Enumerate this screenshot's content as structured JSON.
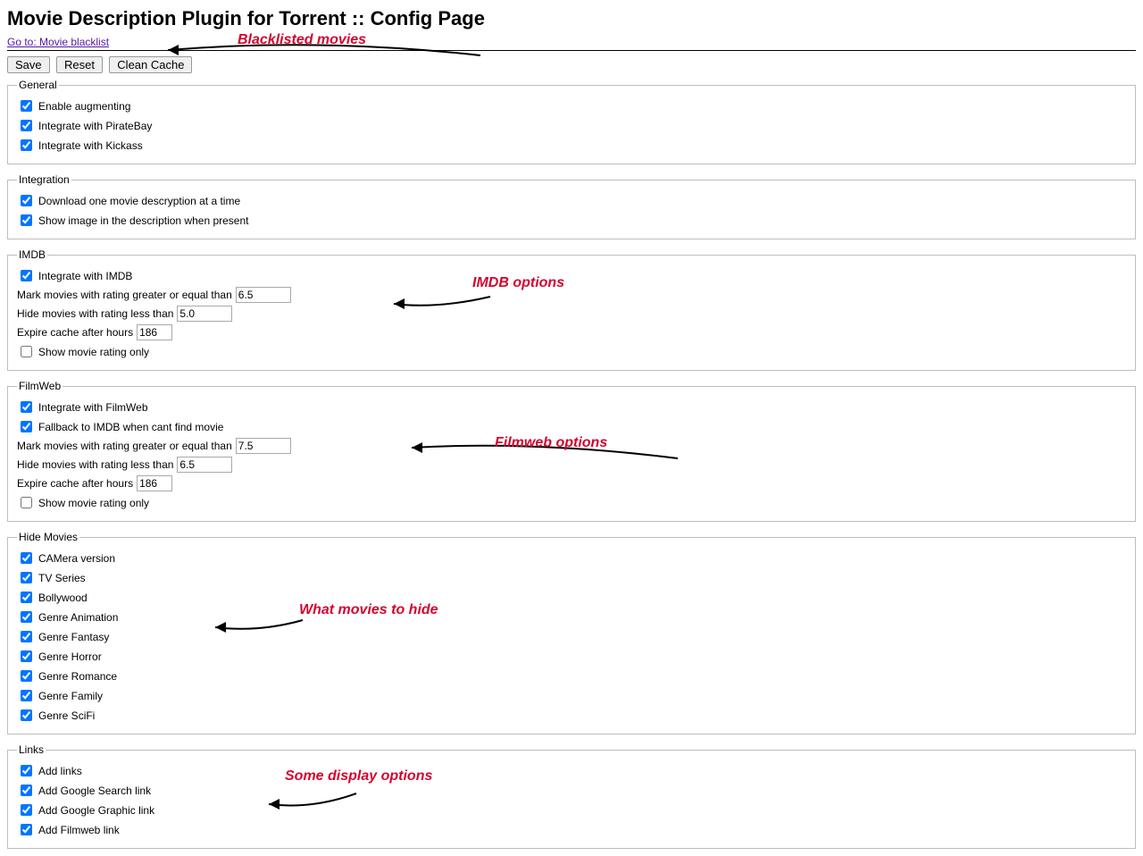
{
  "page": {
    "title": "Movie Description Plugin for Torrent :: Config Page",
    "nav": {
      "blacklist": "Go to: Movie blacklist"
    },
    "buttons": {
      "save": "Save",
      "reset": "Reset",
      "clean_cache": "Clean Cache"
    }
  },
  "annotations": {
    "blacklist": "Blacklisted movies",
    "imdb": "IMDB options",
    "filmweb": "Filmweb options",
    "hide": "What movies to hide",
    "links": "Some display options"
  },
  "general": {
    "legend": "General",
    "enable_augmenting": "Enable augmenting",
    "integrate_piratebay": "Integrate with PirateBay",
    "integrate_kickass": "Integrate with Kickass"
  },
  "integration": {
    "legend": "Integration",
    "download_one": "Download one movie descryption at a time",
    "show_image": "Show image in the description when present"
  },
  "imdb": {
    "legend": "IMDB",
    "integrate": "Integrate with IMDB",
    "mark_label": "Mark movies with rating greater or equal than",
    "mark_value": "6.5",
    "hide_label": "Hide movies with rating less than",
    "hide_value": "5.0",
    "cache_label": "Expire cache after hours",
    "cache_value": "186",
    "rating_only": "Show movie rating only"
  },
  "filmweb": {
    "legend": "FilmWeb",
    "integrate": "Integrate with FilmWeb",
    "fallback": "Fallback to IMDB when cant find movie",
    "mark_label": "Mark movies with rating greater or equal than",
    "mark_value": "7.5",
    "hide_label": "Hide movies with rating less than",
    "hide_value": "6.5",
    "cache_label": "Expire cache after hours",
    "cache_value": "186",
    "rating_only": "Show movie rating only"
  },
  "hide_movies": {
    "legend": "Hide Movies",
    "items": [
      "CAMera version",
      "TV Series",
      "Bollywood",
      "Genre Animation",
      "Genre Fantasy",
      "Genre Horror",
      "Genre Romance",
      "Genre Family",
      "Genre SciFi"
    ]
  },
  "links": {
    "legend": "Links",
    "items": [
      "Add links",
      "Add Google Search link",
      "Add Google Graphic link",
      "Add Filmweb link"
    ]
  }
}
